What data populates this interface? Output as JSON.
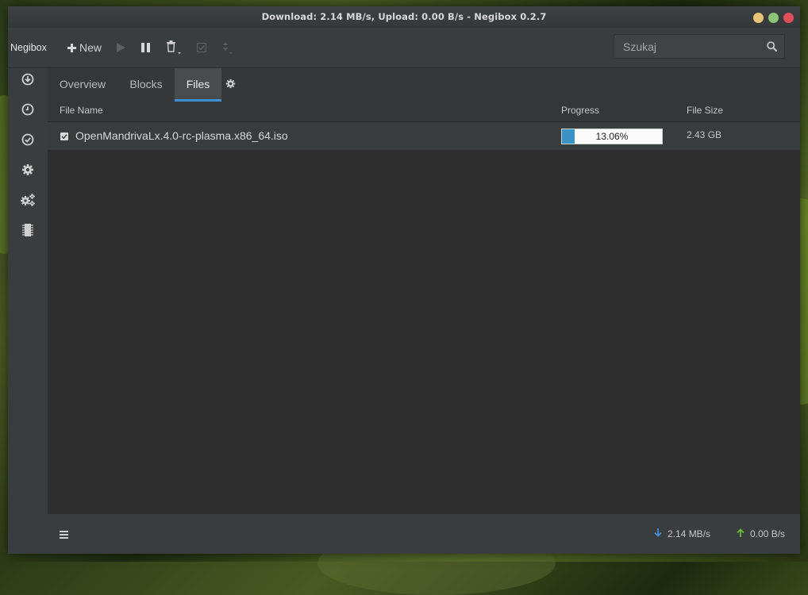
{
  "window": {
    "title": "Download: 2.14 MB/s, Upload: 0.00 B/s - Negibox 0.2.7",
    "controls": {
      "minimize_color": "#e9c477",
      "maximize_color": "#8cc47a",
      "close_color": "#e0505b"
    }
  },
  "toolbar": {
    "app_name": "Negibox",
    "new_label": "New",
    "icons": [
      "plus-icon",
      "play-icon",
      "pause-icon",
      "trash-icon",
      "check-icon",
      "sort-icon"
    ]
  },
  "search": {
    "placeholder": "Szukaj",
    "value": "",
    "icon": "search-icon"
  },
  "sidebar": {
    "items": [
      "download-icon",
      "clock-icon",
      "check-circle-icon",
      "gear-icon",
      "gears-icon",
      "chip-icon"
    ]
  },
  "tabs": [
    {
      "label": "Overview",
      "active": false
    },
    {
      "label": "Blocks",
      "active": false
    },
    {
      "label": "Files",
      "active": true
    }
  ],
  "files_table": {
    "columns": [
      "File Name",
      "Progress",
      "File Size"
    ],
    "rows": [
      {
        "checked": true,
        "name": "OpenMandrivaLx.4.0-rc-plasma.x86_64.iso",
        "progress": 13.06,
        "progress_label": "13.06%",
        "size": "2.43 GB"
      }
    ]
  },
  "status": {
    "download_speed": "2.14 MB/s",
    "upload_speed": "0.00 B/s",
    "download_color": "#3e8fd6",
    "upload_color": "#6fb93a"
  },
  "colors": {
    "accent": "#3e8fd6",
    "progress_fill": "#3a91c6"
  }
}
